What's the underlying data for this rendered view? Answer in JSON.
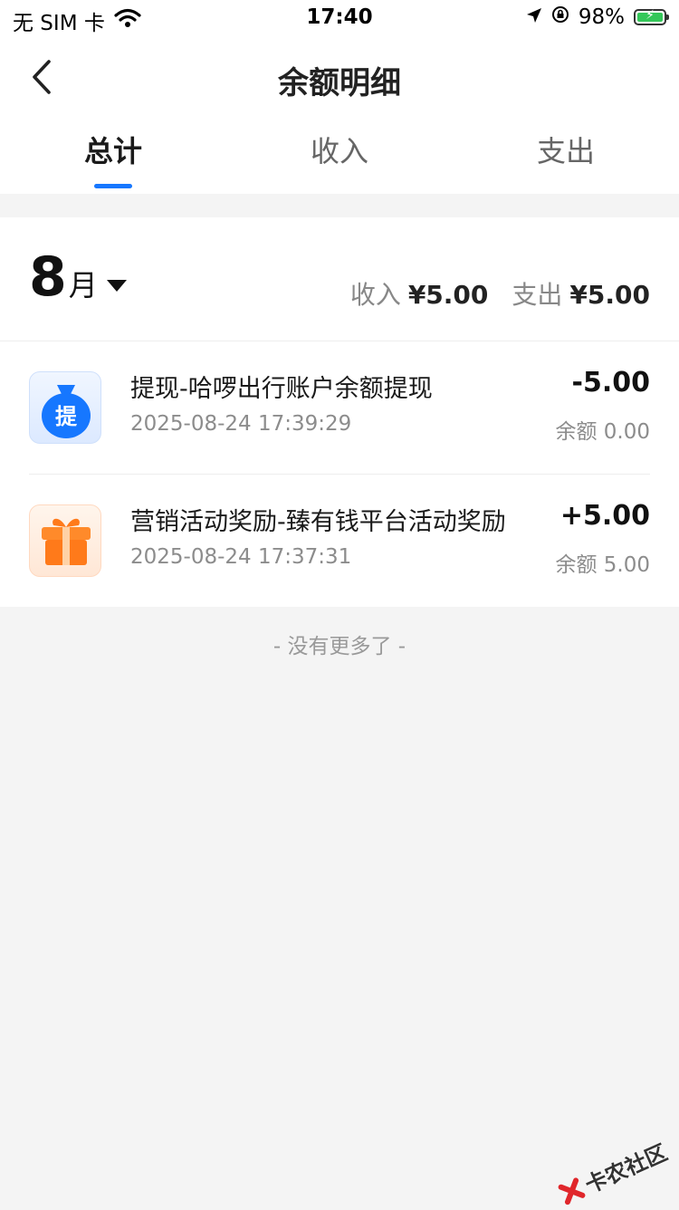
{
  "status_bar": {
    "carrier": "无 SIM 卡",
    "time": "17:40",
    "battery": "98%"
  },
  "header": {
    "title": "余额明细"
  },
  "tabs": [
    {
      "label": "总计",
      "active": true
    },
    {
      "label": "收入",
      "active": false
    },
    {
      "label": "支出",
      "active": false
    }
  ],
  "summary": {
    "month_num": "8",
    "month_unit": "月",
    "income_label": "收入",
    "income_value": "¥5.00",
    "expense_label": "支出",
    "expense_value": "¥5.00"
  },
  "transactions": [
    {
      "title": "提现-哈啰出行账户余额提现",
      "datetime": "2025-08-24 17:39:29",
      "amount": "-5.00",
      "balance": "余额 0.00",
      "icon": "money-bag-icon",
      "icon_text": "提",
      "icon_color": "#1677ff"
    },
    {
      "title": "营销活动奖励-臻有钱平台活动奖励",
      "datetime": "2025-08-24 17:37:31",
      "amount": "+5.00",
      "balance": "余额 5.00",
      "icon": "gift-icon",
      "icon_color": "#ff7a1a"
    }
  ],
  "footer": {
    "no_more": "- 没有更多了 -"
  },
  "watermark": {
    "text": "卡农社区"
  },
  "colors": {
    "accent": "#1677ff",
    "background": "#f4f4f4"
  }
}
